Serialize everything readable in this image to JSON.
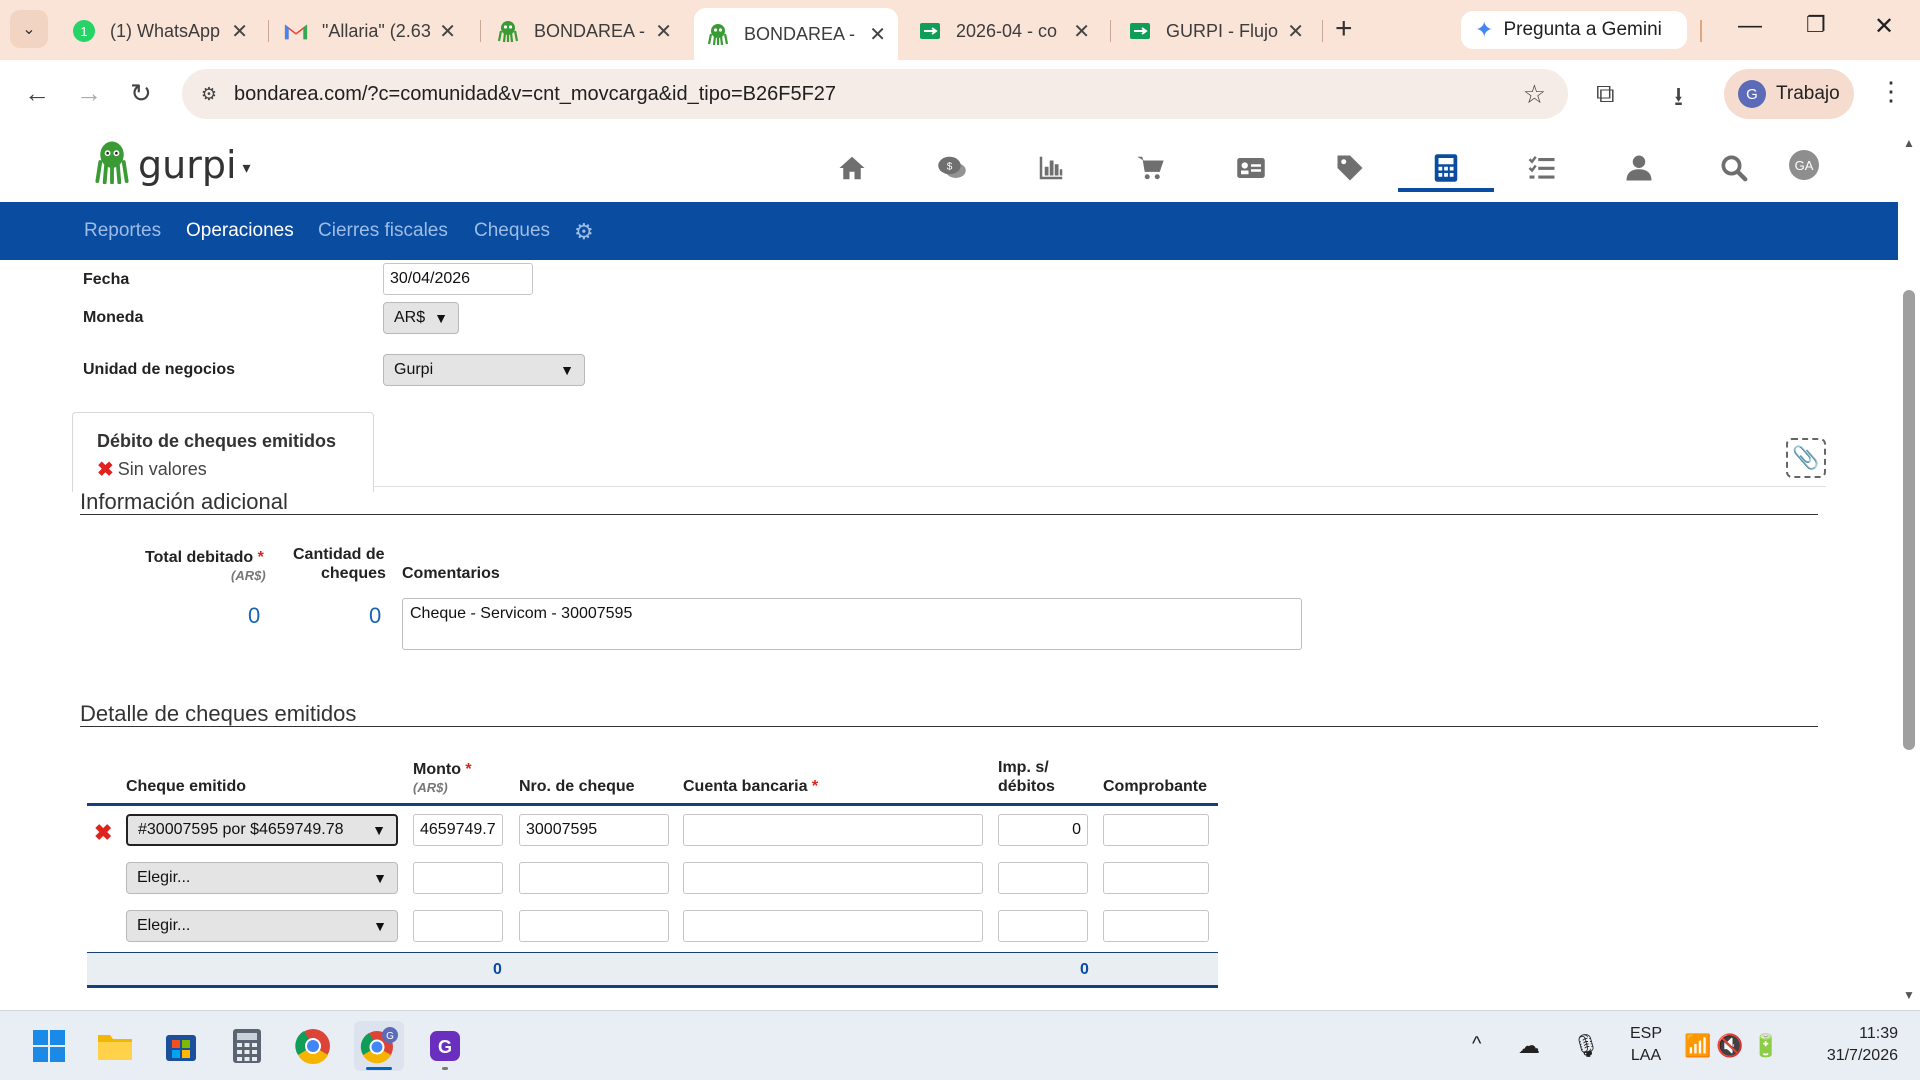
{
  "browser": {
    "tabs": [
      {
        "title": "(1) WhatsApp",
        "icon": "whatsapp-icon",
        "active": false
      },
      {
        "title": "\"Allaria\" (2.63",
        "icon": "gmail-icon",
        "active": false
      },
      {
        "title": "BONDAREA -",
        "icon": "octopus-icon",
        "active": false
      },
      {
        "title": "BONDAREA -",
        "icon": "octopus-icon",
        "active": true
      },
      {
        "title": "2026-04 - co",
        "icon": "sheets-icon",
        "active": false
      },
      {
        "title": "GURPI - Flujo",
        "icon": "sheets-icon",
        "active": false
      }
    ],
    "new_tab": "+",
    "gemini_label": "Pregunta a Gemini",
    "url": "bondarea.com/?c=comunidad&v=cnt_movcarga&id_tipo=B26F5F27",
    "profile_initial": "G",
    "profile_label": "Trabajo"
  },
  "app": {
    "brand": "gurpi",
    "user_initials": "GA",
    "nav_icons": [
      "home-icon",
      "chat-money-icon",
      "chart-icon",
      "cart-icon",
      "id-card-icon",
      "tag-icon",
      "calculator-icon",
      "checklist-icon",
      "user-icon",
      "search-icon"
    ],
    "active_nav": "calculator-icon",
    "subnav": [
      {
        "label": "Reportes",
        "active": false
      },
      {
        "label": "Operaciones",
        "active": true
      },
      {
        "label": "Cierres fiscales",
        "active": false
      },
      {
        "label": "Cheques",
        "active": false
      }
    ]
  },
  "form": {
    "fecha_label": "Fecha",
    "fecha_value": "30/04/2026",
    "moneda_label": "Moneda",
    "moneda_value": "AR$",
    "unidad_label": "Unidad de negocios",
    "unidad_value": "Gurpi",
    "card_title": "Débito de cheques emitidos",
    "card_status": "Sin valores"
  },
  "info": {
    "title": "Información adicional",
    "total_label": "Total debitado",
    "total_unit": "(AR$)",
    "total_value": "0",
    "cantidad_label_1": "Cantidad de",
    "cantidad_label_2": "cheques",
    "cantidad_value": "0",
    "comentarios_label": "Comentarios",
    "comentarios_value": "Cheque - Servicom - 30007595"
  },
  "detalle": {
    "title": "Detalle de cheques emitidos",
    "headers": {
      "cheque": "Cheque emitido",
      "monto": "Monto",
      "monto_unit": "(AR$)",
      "nro": "Nro. de cheque",
      "cuenta": "Cuenta bancaria",
      "imp_1": "Imp. s/",
      "imp_2": "débitos",
      "comprobante": "Comprobante"
    },
    "rows": [
      {
        "cheque": "#30007595 por $4659749.78",
        "monto": "4659749.7",
        "nro": "30007595",
        "cuenta": "",
        "imp": "0",
        "comprobante": ""
      },
      {
        "cheque": "Elegir...",
        "monto": "",
        "nro": "",
        "cuenta": "",
        "imp": "",
        "comprobante": ""
      },
      {
        "cheque": "Elegir...",
        "monto": "",
        "nro": "",
        "cuenta": "",
        "imp": "",
        "comprobante": ""
      }
    ],
    "total_monto": "0",
    "total_imp": "0"
  },
  "taskbar": {
    "lang_1": "ESP",
    "lang_2": "LAA",
    "time": "11:39",
    "date": "31/7/2026"
  }
}
